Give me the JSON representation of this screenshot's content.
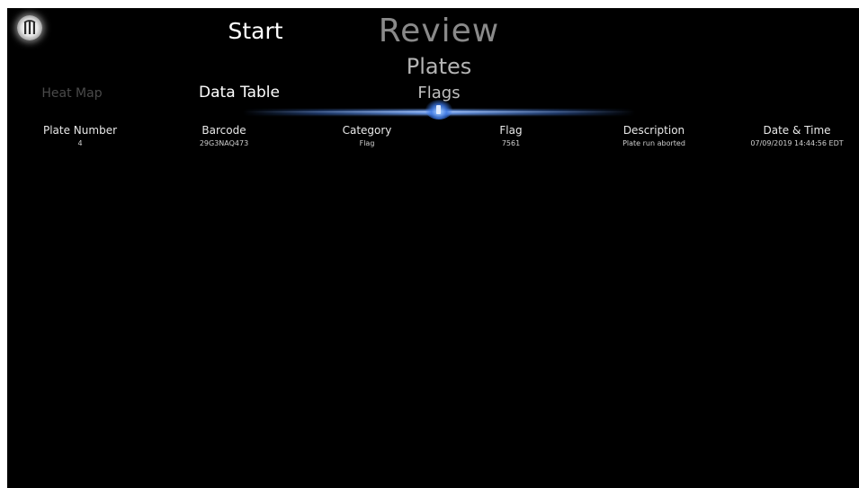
{
  "nav": {
    "start_label": "Start",
    "review_label": "Review",
    "plates_label": "Plates"
  },
  "tabs": {
    "heat_map": "Heat Map",
    "data_table": "Data Table",
    "flags": "Flags"
  },
  "table": {
    "columns": [
      "Plate Number",
      "Barcode",
      "Category",
      "Flag",
      "Description",
      "Date & Time"
    ],
    "rows": [
      [
        "4",
        "29G3NAQ473",
        "Flag",
        "7561",
        "Plate run aborted",
        "07/09/2019 14:44:56 EDT"
      ]
    ]
  },
  "colors": {
    "background": "#000000",
    "accent_glow": "#5a8cff",
    "inactive_tab": "#4a4a4a"
  },
  "icons": {
    "logo": "app-logo-icon"
  }
}
